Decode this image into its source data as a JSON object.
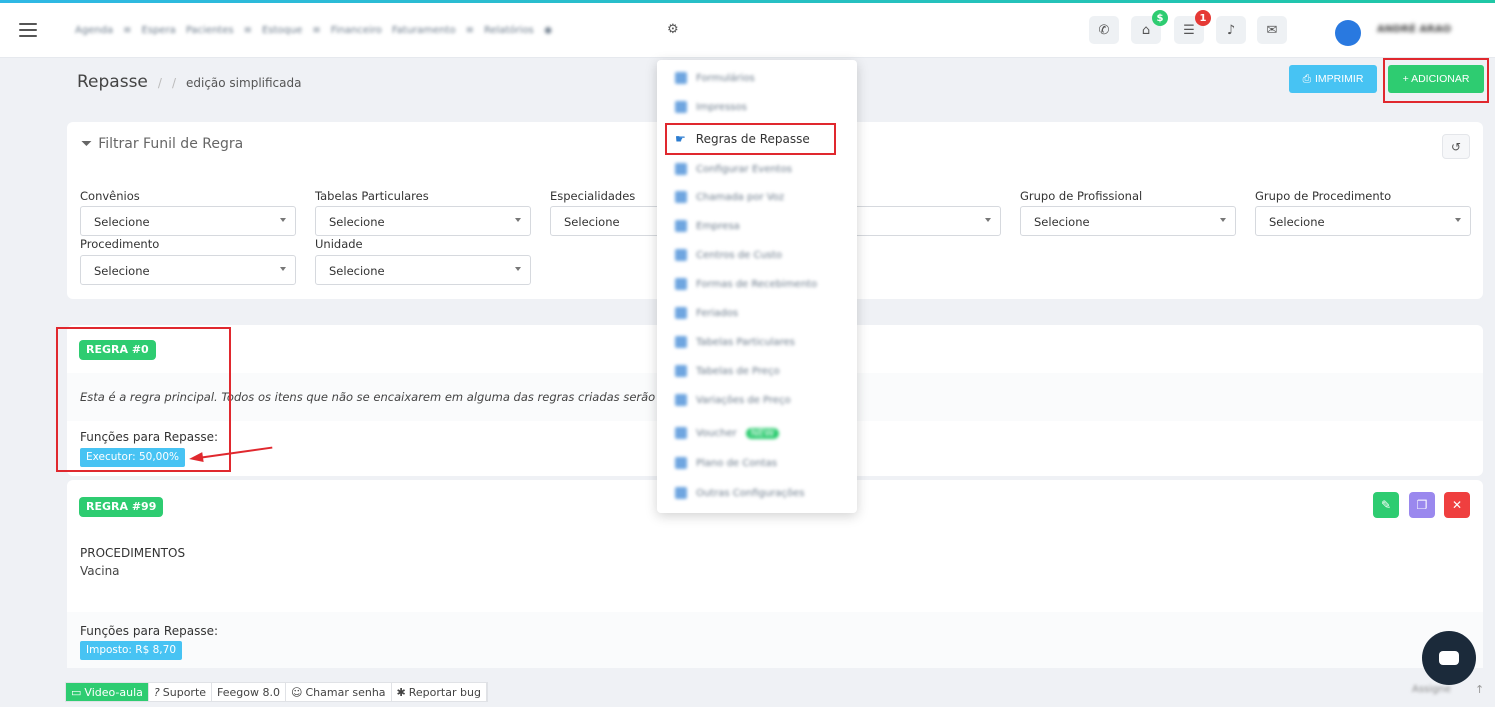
{
  "topnav": {
    "items": [
      "Agenda",
      "Espera",
      "Pacientes",
      "Estoque",
      "Financeiro",
      "Faturamento",
      "Relatórios"
    ],
    "icons": [
      "menu-icon",
      "settings-gear-icon",
      "phone-icon",
      "inbox-icon",
      "tasks-icon",
      "bell-icon",
      "chat-icon"
    ],
    "badges": {
      "inbox": "$",
      "tasks": "1"
    },
    "badge_colors": {
      "inbox": "#2ecc71",
      "tasks": "#e53935"
    },
    "user": "ANDRÉ ARAO"
  },
  "breadcrumb": {
    "title": "Repasse",
    "sep": "/",
    "sep2": "/",
    "current": "edição simplificada"
  },
  "actions": {
    "print": "IMPRIMIR",
    "add": "+ ADICIONAR",
    "print_color": "#47c3f3",
    "add_color": "#2ecc71"
  },
  "filter": {
    "title": "Filtrar Funil de Regra",
    "fields": [
      {
        "label": "Convênios",
        "value": "Selecione"
      },
      {
        "label": "Tabelas Particulares",
        "value": "Selecione"
      },
      {
        "label": "Especialidades",
        "value": "Selecione"
      },
      {
        "label": "",
        "value": ""
      },
      {
        "label": "Grupo de Profissional",
        "value": "Selecione"
      },
      {
        "label": "Grupo de Procedimento",
        "value": "Selecione"
      },
      {
        "label": "Procedimento",
        "value": "Selecione"
      },
      {
        "label": "Unidade",
        "value": "Selecione"
      }
    ]
  },
  "rule0": {
    "badge": "REGRA #0",
    "description": "Esta é a regra principal. Todos os itens que não se encaixarem em alguma das regras criadas serão ad",
    "functions_label": "Funções para Repasse:",
    "tag": "Executor: 50,00%"
  },
  "rule99": {
    "badge": "REGRA #99",
    "section": "PROCEDIMENTOS",
    "value": "Vacina",
    "functions_label": "Funções para Repasse:",
    "tag": "Imposto: R$ 8,70",
    "action_icons": [
      "edit-icon",
      "duplicate-icon",
      "delete-icon"
    ]
  },
  "dropdown": {
    "items": [
      "Formulários",
      "Impressos",
      "Regras de Repasse",
      "Configurar Eventos",
      "Chamada por Voz",
      "Empresa",
      "Centros de Custo",
      "Formas de Recebimento",
      "Feriados",
      "Tabelas Particulares",
      "Tabelas de Preço",
      "Variações de Preço",
      "Voucher",
      "Plano de Contas",
      "Outras Configurações"
    ],
    "selected_index": 2,
    "voucher_badge": "NEW"
  },
  "footer": {
    "items": [
      "Video-aula",
      "Suporte",
      "Feegow 8.0",
      "Chamar senha",
      "Reportar bug"
    ],
    "right_text": "Assigne"
  }
}
